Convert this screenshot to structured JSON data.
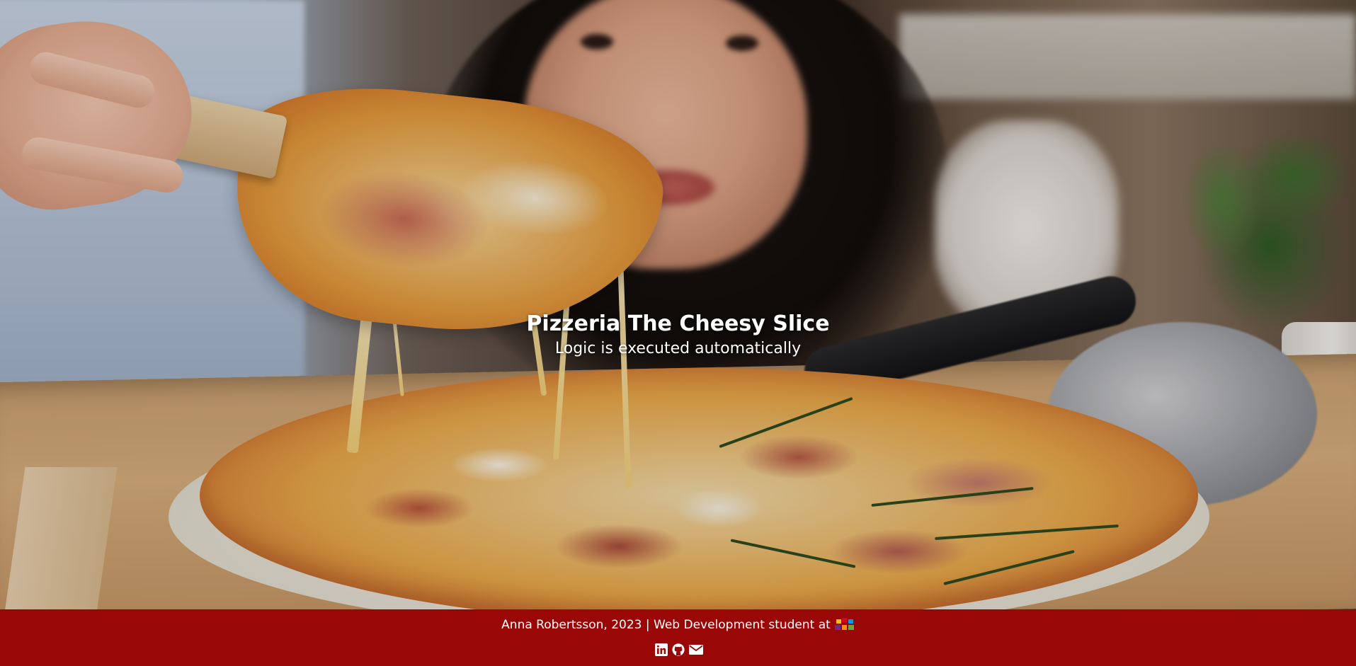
{
  "header": {
    "title": "Pizzeria The Cheesy Slice",
    "subtitle": "Logic is executed automatically"
  },
  "hero": {
    "image": "pizza-photo"
  },
  "footer": {
    "credit": "Anna Robertsson, 2023 | Web Development student at",
    "school_logo": "school-logo-icon",
    "background_color": "#9a0707",
    "social_links": [
      {
        "icon": "linkedin-icon"
      },
      {
        "icon": "github-icon"
      },
      {
        "icon": "email-icon"
      }
    ]
  }
}
